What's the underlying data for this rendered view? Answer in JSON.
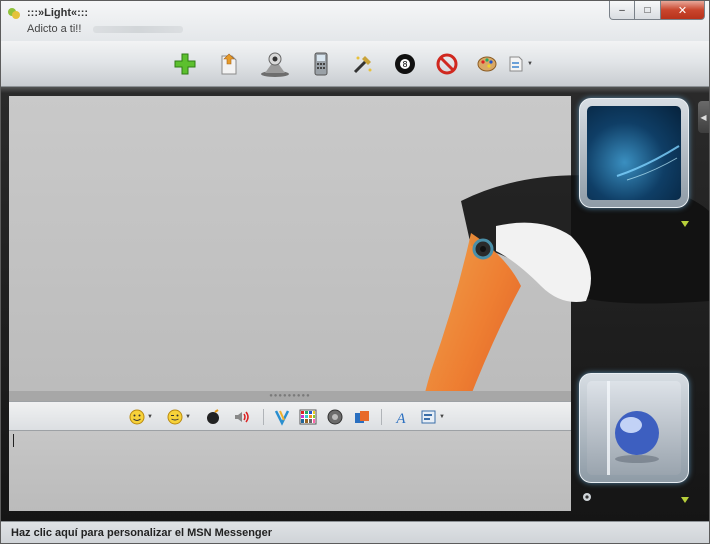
{
  "window": {
    "contact_name": ":::»Light«:::",
    "contact_status": "Adicto a ti!!",
    "controls": {
      "minimize": "–",
      "maximize": "□",
      "close": "✕"
    }
  },
  "toolbar": {
    "items": [
      {
        "icon": "add-contact-icon"
      },
      {
        "icon": "send-file-icon"
      },
      {
        "icon": "webcam-icon"
      },
      {
        "icon": "phone-icon"
      },
      {
        "icon": "activities-icon"
      },
      {
        "icon": "games-icon"
      },
      {
        "icon": "block-icon"
      },
      {
        "icon": "palette-icon"
      },
      {
        "icon": "more-icon"
      }
    ]
  },
  "input_toolbar": {
    "items": [
      {
        "icon": "emoticon-icon",
        "dropdown": true
      },
      {
        "icon": "wink-icon",
        "dropdown": true
      },
      {
        "icon": "nudge-icon"
      },
      {
        "icon": "voice-clip-icon"
      },
      {
        "icon": "ink-icon"
      },
      {
        "icon": "background-icon"
      },
      {
        "icon": "sound-icon"
      },
      {
        "icon": "share-icon"
      },
      {
        "icon": "font-icon"
      },
      {
        "icon": "format-icon",
        "dropdown": true
      }
    ]
  },
  "statusbar": {
    "text": "Haz clic aquí para personalizar el MSN Messenger"
  },
  "colors": {
    "accent_green": "#b7cf3a",
    "close_red": "#c9452d",
    "frame_glow": "#78c8ff"
  }
}
